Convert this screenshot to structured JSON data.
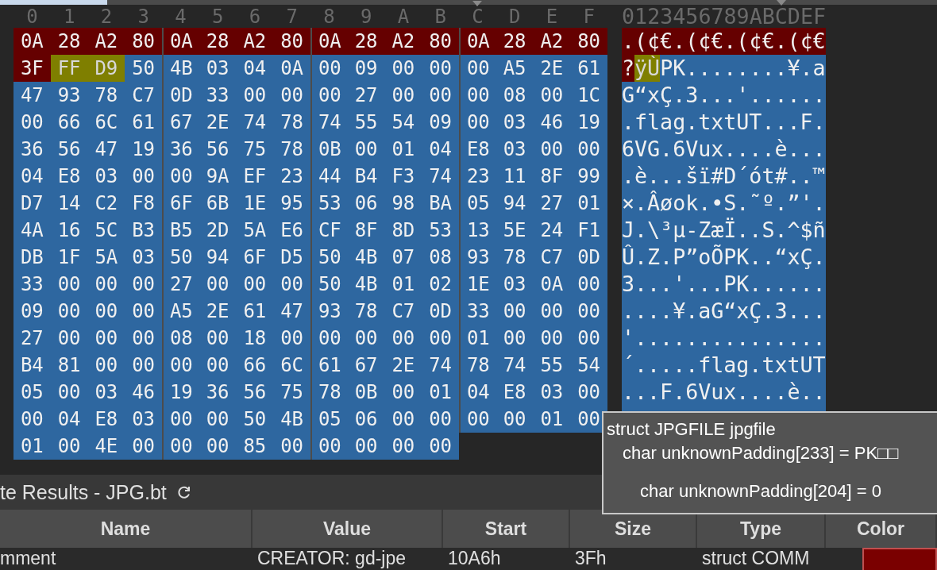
{
  "hex_view": {
    "column_headers": [
      {
        "label": "0",
        "cursor": false
      },
      {
        "label": "1",
        "cursor": false
      },
      {
        "label": "2",
        "cursor": false
      },
      {
        "label": "3",
        "cursor": false
      },
      {
        "label": "4",
        "cursor": false
      },
      {
        "label": "5",
        "cursor": false
      },
      {
        "label": "6",
        "cursor": false
      },
      {
        "label": "7",
        "cursor": false
      },
      {
        "label": "8",
        "cursor": false
      },
      {
        "label": "9",
        "cursor": false
      },
      {
        "label": "A",
        "cursor": false
      },
      {
        "label": "B",
        "cursor": false
      },
      {
        "label": "C",
        "cursor": true
      },
      {
        "label": "D",
        "cursor": false
      },
      {
        "label": "E",
        "cursor": false
      },
      {
        "label": "F",
        "cursor": false
      }
    ],
    "text_header": "0123456789ABCDEF",
    "rows": [
      {
        "bytes": [
          {
            "kind": "comment",
            "values": [
              "0A",
              "28",
              "A2",
              "80",
              "0A",
              "28",
              "A2",
              "80",
              "0A",
              "28",
              "A2",
              "80",
              "0A",
              "28",
              "A2",
              "80"
            ]
          }
        ],
        "text": [
          {
            "kind": "comment",
            "text": ".(¢€.(¢€.(¢€.(¢€"
          }
        ]
      },
      {
        "bytes": [
          {
            "kind": "comment",
            "values": [
              "3F"
            ]
          },
          {
            "kind": "selection",
            "values": [
              "FF",
              "D9"
            ]
          },
          {
            "kind": "data",
            "values": [
              "50",
              "4B",
              "03",
              "04",
              "0A",
              "00",
              "09",
              "00",
              "00",
              "00",
              "A5",
              "2E",
              "61"
            ]
          }
        ],
        "text": [
          {
            "kind": "comment",
            "text": "?"
          },
          {
            "kind": "selection",
            "text": "ÿÙ"
          },
          {
            "kind": "data",
            "text": "PK........¥.a"
          }
        ]
      },
      {
        "bytes": [
          {
            "kind": "data",
            "values": [
              "47",
              "93",
              "78",
              "C7",
              "0D",
              "33",
              "00",
              "00",
              "00",
              "27",
              "00",
              "00",
              "00",
              "08",
              "00",
              "1C"
            ]
          }
        ],
        "text": [
          {
            "kind": "data",
            "text": "G“xÇ.3...'......"
          }
        ]
      },
      {
        "bytes": [
          {
            "kind": "data",
            "values": [
              "00",
              "66",
              "6C",
              "61",
              "67",
              "2E",
              "74",
              "78",
              "74",
              "55",
              "54",
              "09",
              "00",
              "03",
              "46",
              "19"
            ]
          }
        ],
        "text": [
          {
            "kind": "data",
            "text": ".flag.txtUT...F."
          }
        ]
      },
      {
        "bytes": [
          {
            "kind": "data",
            "values": [
              "36",
              "56",
              "47",
              "19",
              "36",
              "56",
              "75",
              "78",
              "0B",
              "00",
              "01",
              "04",
              "E8",
              "03",
              "00",
              "00"
            ]
          }
        ],
        "text": [
          {
            "kind": "data",
            "text": "6VG.6Vux....è..."
          }
        ]
      },
      {
        "bytes": [
          {
            "kind": "data",
            "values": [
              "04",
              "E8",
              "03",
              "00",
              "00",
              "9A",
              "EF",
              "23",
              "44",
              "B4",
              "F3",
              "74",
              "23",
              "11",
              "8F",
              "99"
            ]
          }
        ],
        "text": [
          {
            "kind": "data",
            "text": ".è...šï#D´ót#..™"
          }
        ]
      },
      {
        "bytes": [
          {
            "kind": "data",
            "values": [
              "D7",
              "14",
              "C2",
              "F8",
              "6F",
              "6B",
              "1E",
              "95",
              "53",
              "06",
              "98",
              "BA",
              "05",
              "94",
              "27",
              "01"
            ]
          }
        ],
        "text": [
          {
            "kind": "data",
            "text": "×.Âøok.•S.˜º.”'."
          }
        ]
      },
      {
        "bytes": [
          {
            "kind": "data",
            "values": [
              "4A",
              "16",
              "5C",
              "B3",
              "B5",
              "2D",
              "5A",
              "E6",
              "CF",
              "8F",
              "8D",
              "53",
              "13",
              "5E",
              "24",
              "F1"
            ]
          }
        ],
        "text": [
          {
            "kind": "data",
            "text": "J.\\³µ-ZæÏ..S.^$ñ"
          }
        ]
      },
      {
        "bytes": [
          {
            "kind": "data",
            "values": [
              "DB",
              "1F",
              "5A",
              "03",
              "50",
              "94",
              "6F",
              "D5",
              "50",
              "4B",
              "07",
              "08",
              "93",
              "78",
              "C7",
              "0D"
            ]
          }
        ],
        "text": [
          {
            "kind": "data",
            "text": "Û.Z.P”oÕPK..“xÇ."
          }
        ]
      },
      {
        "bytes": [
          {
            "kind": "data",
            "values": [
              "33",
              "00",
              "00",
              "00",
              "27",
              "00",
              "00",
              "00",
              "50",
              "4B",
              "01",
              "02",
              "1E",
              "03",
              "0A",
              "00"
            ]
          }
        ],
        "text": [
          {
            "kind": "data",
            "text": "3...'...PK......"
          }
        ]
      },
      {
        "bytes": [
          {
            "kind": "data",
            "values": [
              "09",
              "00",
              "00",
              "00",
              "A5",
              "2E",
              "61",
              "47",
              "93",
              "78",
              "C7",
              "0D",
              "33",
              "00",
              "00",
              "00"
            ]
          }
        ],
        "text": [
          {
            "kind": "data",
            "text": "....¥.aG“xÇ.3..."
          }
        ]
      },
      {
        "bytes": [
          {
            "kind": "data",
            "values": [
              "27",
              "00",
              "00",
              "00",
              "08",
              "00",
              "18",
              "00",
              "00",
              "00",
              "00",
              "00",
              "01",
              "00",
              "00",
              "00"
            ]
          }
        ],
        "text": [
          {
            "kind": "data",
            "text": "'..............."
          }
        ]
      },
      {
        "bytes": [
          {
            "kind": "data",
            "values": [
              "B4",
              "81",
              "00",
              "00",
              "00",
              "00",
              "66",
              "6C",
              "61",
              "67",
              "2E",
              "74",
              "78",
              "74",
              "55",
              "54"
            ]
          }
        ],
        "text": [
          {
            "kind": "data",
            "text": "´.....flag.txtUT"
          }
        ]
      },
      {
        "bytes": [
          {
            "kind": "data",
            "values": [
              "05",
              "00",
              "03",
              "46",
              "19",
              "36",
              "56",
              "75",
              "78",
              "0B",
              "00",
              "01",
              "04",
              "E8",
              "03",
              "00"
            ]
          }
        ],
        "text": [
          {
            "kind": "data",
            "text": "...F.6Vux....è.."
          }
        ]
      },
      {
        "bytes": [
          {
            "kind": "data",
            "values": [
              "00",
              "04",
              "E8",
              "03",
              "00",
              "00",
              "50",
              "4B",
              "05",
              "06",
              "00",
              "00",
              "00",
              "00",
              "01",
              "00"
            ]
          }
        ],
        "text": [
          {
            "kind": "data"
          }
        ]
      },
      {
        "bytes": [
          {
            "kind": "data",
            "values": [
              "01",
              "00",
              "4E",
              "00",
              "00",
              "00",
              "85",
              "00",
              "00",
              "00",
              "00",
              "00"
            ]
          }
        ]
      }
    ]
  },
  "results_panel": {
    "title": "te Results - JPG.bt",
    "columns": [
      "Name",
      "Value",
      "Start",
      "Size",
      "Type",
      "Color"
    ],
    "rows": [
      {
        "cells": [
          {
            "kind": "text",
            "text": "mment"
          },
          {
            "kind": "text",
            "text": "CREATOR: gd-jpe"
          },
          {
            "kind": "text",
            "text": "10A6h"
          },
          {
            "kind": "text",
            "text": "3Fh"
          },
          {
            "kind": "text",
            "text": "struct COMM"
          },
          {
            "kind": "swatch",
            "color": "#7a0000"
          }
        ]
      }
    ]
  },
  "tooltip": {
    "title": "struct JPGFILE jpgfile",
    "fields": [
      "char unknownPadding[233] = PK□□",
      "char unknownPadding[204] = 0"
    ]
  }
}
